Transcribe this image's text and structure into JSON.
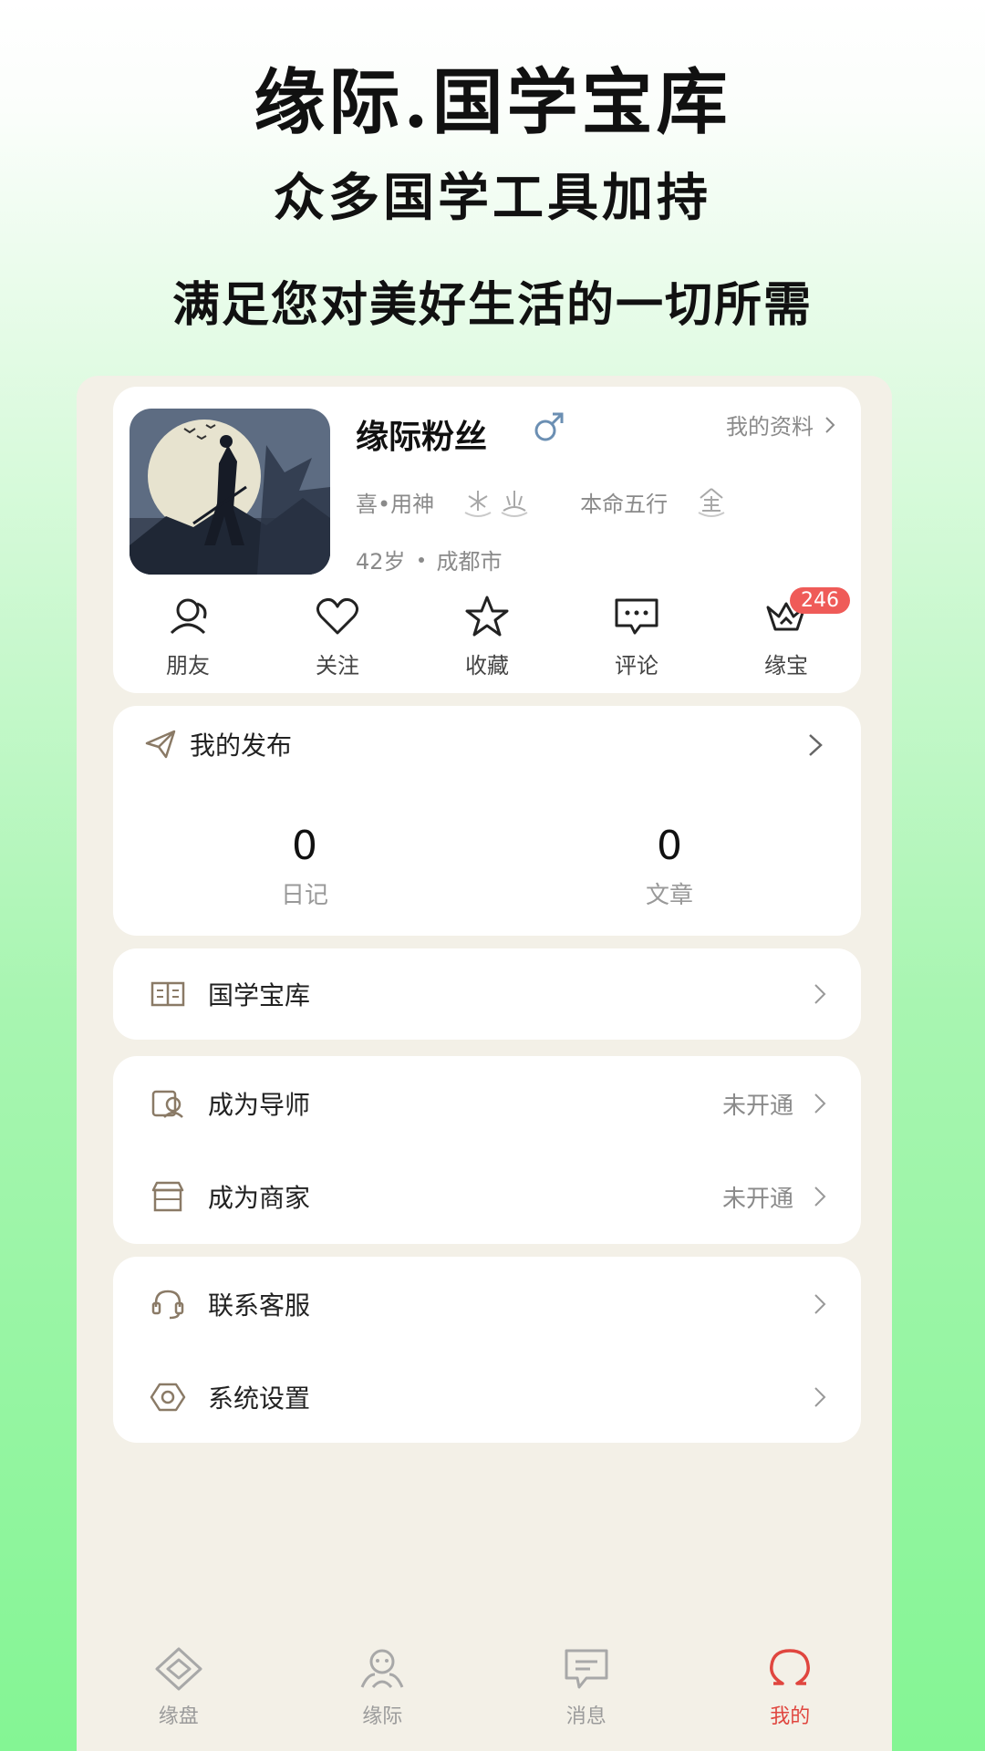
{
  "promo": {
    "title": "缘际.国学宝库",
    "subtitle1": "众多国学工具加持",
    "subtitle2": "满足您对美好生活的一切所需"
  },
  "profile": {
    "nickname": "缘际粉丝",
    "gender_icon": "male-symbol",
    "my_data_label": "我的资料",
    "favorable_label": "喜•用神",
    "element_label": "本命五行",
    "age": "42岁",
    "city": "成都市"
  },
  "quick_actions": [
    {
      "label": "朋友",
      "icon": "friends-icon"
    },
    {
      "label": "关注",
      "icon": "heart-icon"
    },
    {
      "label": "收藏",
      "icon": "star-icon"
    },
    {
      "label": "评论",
      "icon": "comment-icon"
    },
    {
      "label": "缘宝",
      "icon": "crown-icon",
      "badge": "246"
    }
  ],
  "publish": {
    "title": "我的发布",
    "stats": [
      {
        "value": "0",
        "label": "日记"
      },
      {
        "value": "0",
        "label": "文章"
      }
    ]
  },
  "menu": {
    "library": "国学宝库",
    "mentor": {
      "label": "成为导师",
      "status": "未开通"
    },
    "merchant": {
      "label": "成为商家",
      "status": "未开通"
    },
    "support": "联系客服",
    "settings": "系统设置"
  },
  "tabs": [
    {
      "label": "缘盘",
      "active": false
    },
    {
      "label": "缘际",
      "active": false
    },
    {
      "label": "消息",
      "active": false
    },
    {
      "label": "我的",
      "active": true
    }
  ],
  "colors": {
    "accent": "#e0463f",
    "badge": "#ef5b58",
    "gender": "#6b8fb3",
    "icon_gold": "#a0896a"
  }
}
